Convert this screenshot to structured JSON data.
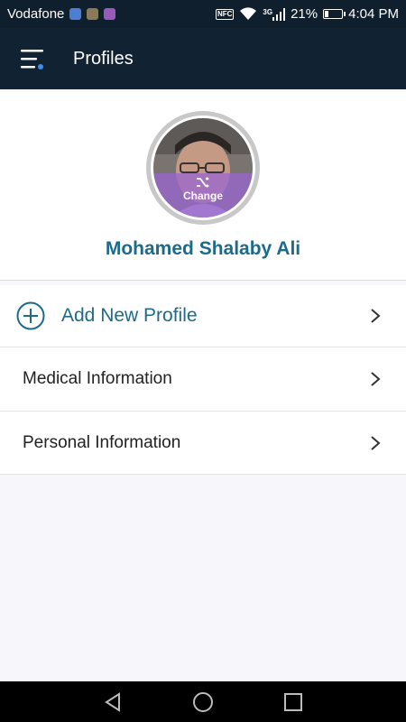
{
  "status_bar": {
    "carrier": "Vodafone",
    "nfc": "NFC",
    "network_type": "3G",
    "battery_percent": "21%",
    "battery_level": 0.21,
    "time": "4:04 PM"
  },
  "app_bar": {
    "title": "Profiles",
    "menu_icon": "hamburger-menu-icon"
  },
  "profile": {
    "name": "Mohamed Shalaby Ali",
    "change_label": "Change"
  },
  "list": {
    "add_profile": "Add New Profile",
    "medical_information": "Medical Information",
    "personal_information": "Personal Information"
  },
  "nav": {
    "back_icon": "back-triangle-icon",
    "home_icon": "home-circle-icon",
    "recents_icon": "recents-square-icon"
  },
  "colors": {
    "app_bar": "#112233",
    "accent": "#1d6b8a",
    "menu_dot": "#3b8ee8",
    "change_overlay": "#9b64d2"
  }
}
